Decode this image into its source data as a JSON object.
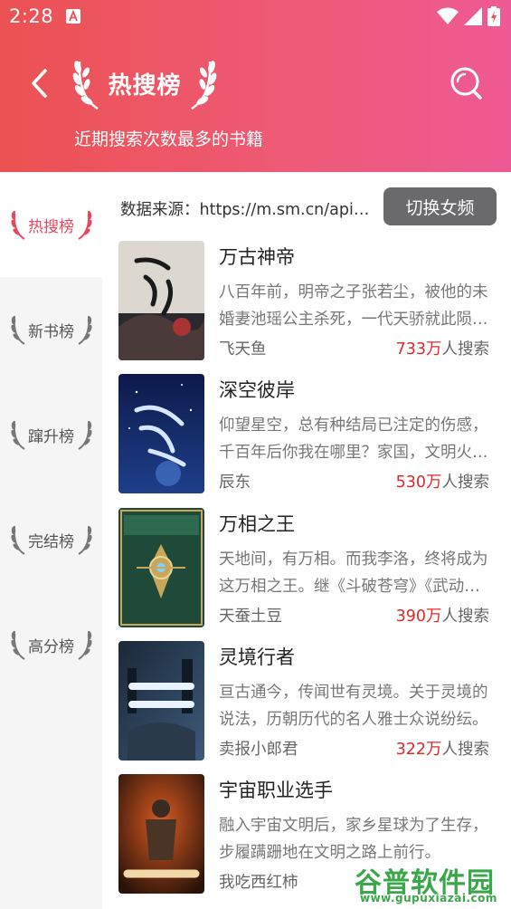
{
  "status_bar": {
    "time": "2:28"
  },
  "header": {
    "title": "热搜榜",
    "subtitle": "近期搜索次数最多的书籍"
  },
  "sidebar": {
    "items": [
      {
        "label": "热搜榜",
        "active": true
      },
      {
        "label": "新书榜",
        "active": false
      },
      {
        "label": "蹿升榜",
        "active": false
      },
      {
        "label": "完结榜",
        "active": false
      },
      {
        "label": "高分榜",
        "active": false
      }
    ]
  },
  "content": {
    "source": "数据来源：https://m.sm.cn/api/rest?format=html",
    "switch_label": "切换女频",
    "count_suffix": "人搜索",
    "books": [
      {
        "title": "万古神帝",
        "desc": "八百年前，明帝之子张若尘，被他的未婚妻池瑶公主杀死，一代天骄就此陨落。",
        "author": "飞天鱼",
        "count": "733万"
      },
      {
        "title": "深空彼岸",
        "desc": "仰望星空，总有种结局已注定的伤感，千百年后你我在哪里？家国，文明火光，地球，都在何方？",
        "author": "辰东",
        "count": "530万"
      },
      {
        "title": "万相之王",
        "desc": "天地间，有万相。而我李洛，终将成为这万相之王。继《斗破苍穹》《武动乾坤》之后。",
        "author": "天蚕土豆",
        "count": "390万"
      },
      {
        "title": "灵境行者",
        "desc": "亘古通今，传闻世有灵境。关于灵境的说法，历朝历代的名人雅士众说纷纭。",
        "author": "卖报小郎君",
        "count": "322万"
      },
      {
        "title": "宇宙职业选手",
        "desc": "融入宇宙文明后，家乡星球为了生存，步履蹒跚地在文明之路上前行。",
        "author": "我吃西红柿",
        "count": ""
      }
    ]
  },
  "watermark": {
    "main": "谷普软件园",
    "url": "www.gupuxiazai.com"
  },
  "colors": {
    "accent": "#e8455e",
    "count_red": "#e02828",
    "button_gray": "#6a6a6c"
  }
}
